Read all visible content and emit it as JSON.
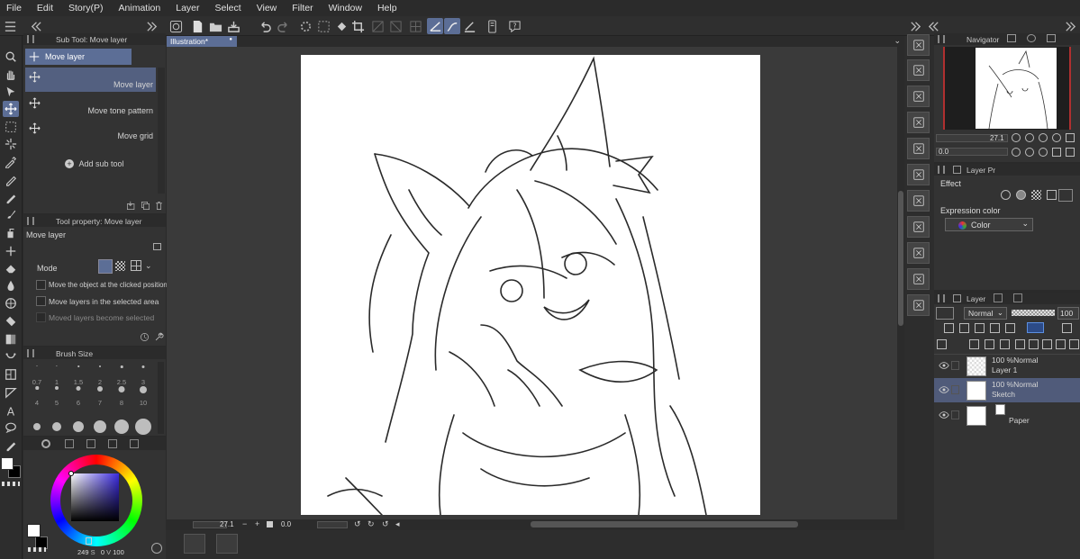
{
  "menu": [
    "File",
    "Edit",
    "Story(P)",
    "Animation",
    "Layer",
    "Select",
    "View",
    "Filter",
    "Window",
    "Help"
  ],
  "document_tab": {
    "title": "Illustration*",
    "modified_dot": "●"
  },
  "subtool_panel": {
    "title": "Sub Tool: Move layer",
    "group_tab": "Move layer",
    "items": [
      {
        "label": "Move layer"
      },
      {
        "label": "Move tone pattern"
      },
      {
        "label": "Move grid"
      }
    ],
    "add_label": "Add sub tool"
  },
  "tool_property": {
    "title": "Tool property: Move layer",
    "name": "Move layer",
    "mode_label": "Mode",
    "options": [
      {
        "label": "Move the object at the clicked position",
        "checked": false
      },
      {
        "label": "Move layers in the selected area",
        "checked": false
      },
      {
        "label": "Moved layers become selected",
        "checked": false,
        "disabled": true
      }
    ]
  },
  "brush_size": {
    "title": "Brush Size",
    "rows": [
      [
        "0.7",
        "1",
        "1.5",
        "2",
        "2.5",
        "3"
      ],
      [
        "4",
        "5",
        "6",
        "7",
        "8",
        "10"
      ]
    ]
  },
  "color": {
    "h_value": "249",
    "s_label": "S",
    "s_value": "0",
    "v_label": "V",
    "v_value": "100"
  },
  "navigator": {
    "title": "Navigator",
    "zoom": "27.1",
    "angle": "0.0"
  },
  "layer_property": {
    "title": "Layer Pr",
    "effect_label": "Effect",
    "expression_label": "Expression color",
    "expression_value": "Color"
  },
  "layer_panel": {
    "title": "Layer",
    "blend_mode": "Normal",
    "opacity": "100",
    "layers": [
      {
        "percent": "100 %",
        "mode": "Normal",
        "name": "Layer 1",
        "selected": false
      },
      {
        "percent": "100 %",
        "mode": "Normal",
        "name": "Sketch",
        "selected": true
      },
      {
        "percent": "",
        "mode": "",
        "name": "Paper",
        "selected": false
      }
    ]
  },
  "statusbar": {
    "zoom": "27.1",
    "angle": "0.0"
  },
  "accent_color": "#5c6e96"
}
